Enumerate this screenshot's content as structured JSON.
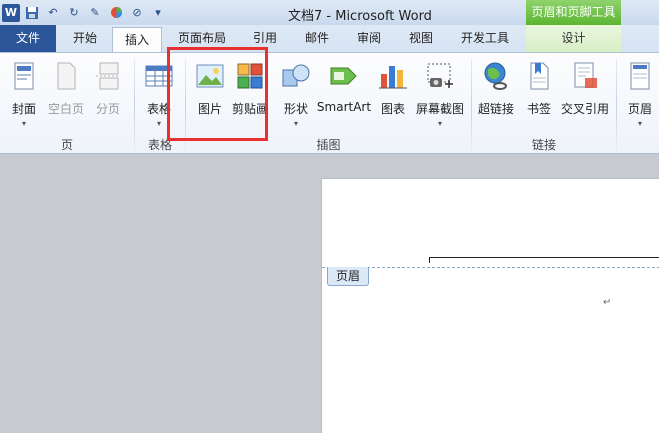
{
  "titlebar": {
    "title": "文档7 - Microsoft Word",
    "context_tool": "页眉和页脚工具",
    "app_icon_letter": "W"
  },
  "tabs": [
    {
      "label": "文件"
    },
    {
      "label": "开始"
    },
    {
      "label": "插入"
    },
    {
      "label": "页面布局"
    },
    {
      "label": "引用"
    },
    {
      "label": "邮件"
    },
    {
      "label": "审阅"
    },
    {
      "label": "视图"
    },
    {
      "label": "开发工具"
    },
    {
      "label": "设计"
    }
  ],
  "ribbon": {
    "page_group": {
      "label": "页",
      "items": [
        "封面",
        "空白页",
        "分页"
      ]
    },
    "table_group": {
      "label": "表格",
      "items": [
        "表格"
      ]
    },
    "illustrations_group": {
      "label": "插图",
      "items": [
        "图片",
        "剪贴画",
        "形状",
        "SmartArt",
        "图表",
        "屏幕截图"
      ]
    },
    "links_group": {
      "label": "链接",
      "items": [
        "超链接",
        "书签",
        "交叉引用"
      ]
    },
    "header_group": {
      "items": [
        "页眉"
      ]
    }
  },
  "document": {
    "header_tag": "页眉",
    "paragraph_mark": "↵"
  },
  "colors": {
    "accent": "#2b579a",
    "context_tab": "#5cb531",
    "highlight_box": "#e8302e"
  }
}
